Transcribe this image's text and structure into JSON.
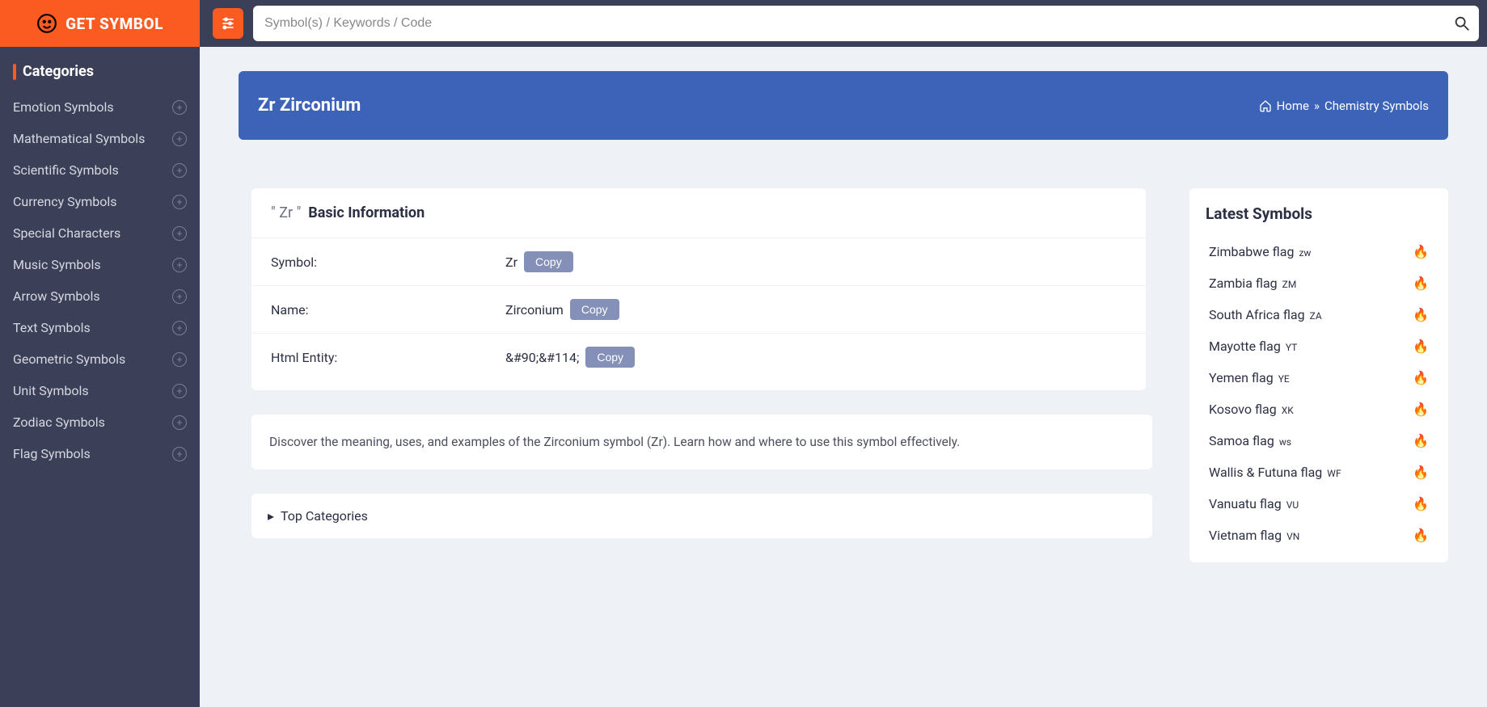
{
  "brand": {
    "name": "GET SYMBOL"
  },
  "sidebar": {
    "heading": "Categories",
    "items": [
      "Emotion Symbols",
      "Mathematical Symbols",
      "Scientific Symbols",
      "Currency Symbols",
      "Special Characters",
      "Music Symbols",
      "Arrow Symbols",
      "Text Symbols",
      "Geometric Symbols",
      "Unit Symbols",
      "Zodiac Symbols",
      "Flag Symbols"
    ]
  },
  "search": {
    "placeholder": "Symbol(s) / Keywords / Code"
  },
  "banner": {
    "title": "Zr Zirconium",
    "breadcrumb": {
      "home": "Home",
      "sep": "»",
      "current": "Chemistry Symbols"
    }
  },
  "info": {
    "symbol_quoted": "\" Zr \"",
    "heading": "Basic Information",
    "rows": [
      {
        "label": "Symbol:",
        "value": "Zr"
      },
      {
        "label": "Name:",
        "value": "Zirconium"
      },
      {
        "label": "Html Entity:",
        "value": "&#90;&#114;"
      }
    ],
    "copy_label": "Copy"
  },
  "description": "Discover the meaning, uses, and examples of the Zirconium symbol (Zr). Learn how and where to use this symbol effectively.",
  "top_categories": {
    "label": "Top Categories"
  },
  "latest": {
    "heading": "Latest Symbols",
    "items": [
      {
        "name": "Zimbabwe flag",
        "code": "zw"
      },
      {
        "name": "Zambia flag",
        "code": "ZM"
      },
      {
        "name": "South Africa flag",
        "code": "ZA"
      },
      {
        "name": "Mayotte flag",
        "code": "YT"
      },
      {
        "name": "Yemen flag",
        "code": "YE"
      },
      {
        "name": "Kosovo flag",
        "code": "XK"
      },
      {
        "name": "Samoa flag",
        "code": "ws"
      },
      {
        "name": "Wallis & Futuna flag",
        "code": "WF"
      },
      {
        "name": "Vanuatu flag",
        "code": "VU"
      },
      {
        "name": "Vietnam flag",
        "code": "VN"
      }
    ]
  }
}
